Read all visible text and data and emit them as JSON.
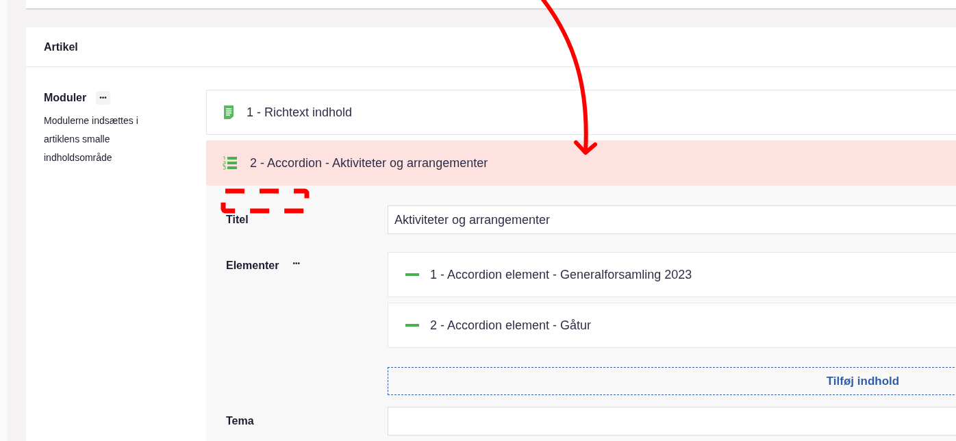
{
  "section": {
    "title": "Artikel"
  },
  "modules_field": {
    "label": "Moduler",
    "menu": "•••",
    "description": "Modulerne indsættes i artiklens smalle indholdsområde"
  },
  "modules": [
    {
      "kind": "document",
      "title": "1 - Richtext indhold",
      "selected": false,
      "expanded": false
    },
    {
      "kind": "list",
      "title": "2 - Accordion - Aktiviteter og arrangementer",
      "selected": true,
      "expanded": true
    }
  ],
  "accordion": {
    "title_label": "Titel",
    "title_value": "Aktiviteter og arrangementer",
    "elements_label": "Elementer",
    "elements_menu": "•••",
    "elements": [
      {
        "title": "1 - Accordion element - Generalforsamling 2023"
      },
      {
        "title": "2 - Accordion element - Gåtur"
      }
    ],
    "add_button": "Tilføj indhold",
    "theme_label": "Tema"
  }
}
